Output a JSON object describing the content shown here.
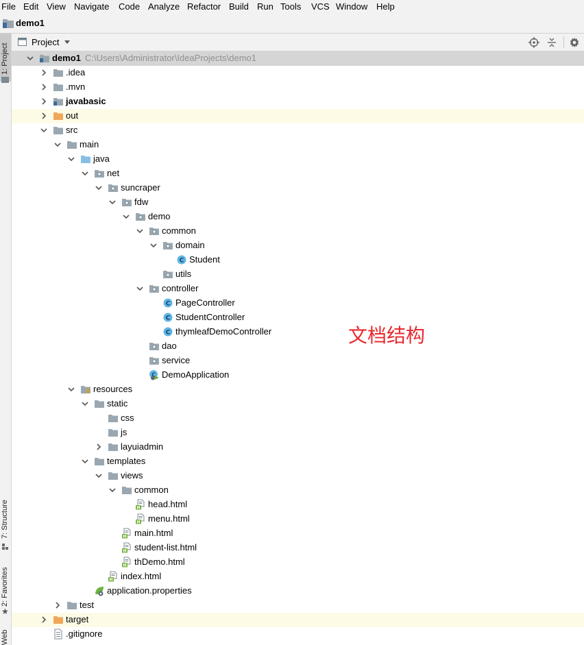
{
  "menu": [
    "File",
    "Edit",
    "View",
    "Navigate",
    "Code",
    "Analyze",
    "Refactor",
    "Build",
    "Run",
    "Tools",
    "VCS",
    "Window",
    "Help"
  ],
  "nav": {
    "project": "demo1"
  },
  "toolbar": {
    "view_mode": "Project"
  },
  "side_tabs": {
    "project": "1: Project",
    "structure": "7: Structure",
    "favorites": "2: Favorites",
    "web": "Web"
  },
  "tree": [
    {
      "label": "demo1",
      "path": "C:\\Users\\Administrator\\IdeaProjects\\demo1",
      "bold": true,
      "icon": "module-folder-icon",
      "expand": "open",
      "selected": true
    },
    {
      "label": ".idea",
      "icon": "folder-icon",
      "expand": "closed"
    },
    {
      "label": ".mvn",
      "icon": "folder-icon",
      "expand": "closed"
    },
    {
      "label": "javabasic",
      "bold": true,
      "icon": "module-folder-icon",
      "expand": "closed"
    },
    {
      "label": "out",
      "icon": "excluded-folder-icon",
      "expand": "closed",
      "highlight": true
    },
    {
      "label": "src",
      "icon": "folder-icon",
      "expand": "open"
    },
    {
      "label": "main",
      "icon": "folder-icon",
      "expand": "open"
    },
    {
      "label": "java",
      "icon": "source-folder-icon",
      "expand": "open"
    },
    {
      "label": "net",
      "icon": "package-icon",
      "expand": "open"
    },
    {
      "label": "suncraper",
      "icon": "package-icon",
      "expand": "open"
    },
    {
      "label": "fdw",
      "icon": "package-icon",
      "expand": "open"
    },
    {
      "label": "demo",
      "icon": "package-icon",
      "expand": "open"
    },
    {
      "label": "common",
      "icon": "package-icon",
      "expand": "open"
    },
    {
      "label": "domain",
      "icon": "package-icon",
      "expand": "open"
    },
    {
      "label": "Student",
      "icon": "class-icon"
    },
    {
      "label": "utils",
      "icon": "package-icon"
    },
    {
      "label": "controller",
      "icon": "package-icon",
      "expand": "open"
    },
    {
      "label": "PageController",
      "icon": "class-icon"
    },
    {
      "label": "StudentController",
      "icon": "class-icon"
    },
    {
      "label": "thymleafDemoController",
      "icon": "class-icon"
    },
    {
      "label": "dao",
      "icon": "package-icon"
    },
    {
      "label": "service",
      "icon": "package-icon"
    },
    {
      "label": "DemoApplication",
      "icon": "spring-boot-class-icon"
    },
    {
      "label": "resources",
      "icon": "resources-folder-icon",
      "expand": "open"
    },
    {
      "label": "static",
      "icon": "folder-icon",
      "expand": "open"
    },
    {
      "label": "css",
      "icon": "folder-icon"
    },
    {
      "label": "js",
      "icon": "folder-icon"
    },
    {
      "label": "layuiadmin",
      "icon": "folder-icon",
      "expand": "closed"
    },
    {
      "label": "templates",
      "icon": "folder-icon",
      "expand": "open"
    },
    {
      "label": "views",
      "icon": "folder-icon",
      "expand": "open"
    },
    {
      "label": "common",
      "icon": "folder-icon",
      "expand": "open"
    },
    {
      "label": "head.html",
      "icon": "html-file-icon"
    },
    {
      "label": "menu.html",
      "icon": "html-file-icon"
    },
    {
      "label": "main.html",
      "icon": "html-file-icon"
    },
    {
      "label": "student-list.html",
      "icon": "html-file-icon"
    },
    {
      "label": "thDemo.html",
      "icon": "html-file-icon"
    },
    {
      "label": "index.html",
      "icon": "html-file-icon"
    },
    {
      "label": "application.properties",
      "icon": "spring-properties-icon"
    },
    {
      "label": "test",
      "icon": "folder-icon",
      "expand": "closed"
    },
    {
      "label": "target",
      "icon": "excluded-folder-icon",
      "expand": "closed",
      "highlight": true
    },
    {
      "label": ".gitignore",
      "icon": "text-file-icon"
    }
  ],
  "annotation": "文档结构",
  "colors": {
    "folder": "#9aa7b0",
    "source_folder": "#87bfe4",
    "excluded_folder": "#f0a75a",
    "class_circle": "#5fb5e5",
    "html_green": "#7cb342",
    "spring_green": "#6db33f",
    "annotation": "#e8282d",
    "selection": "#d5d5d5",
    "highlight_row": "#fdfbe5"
  }
}
